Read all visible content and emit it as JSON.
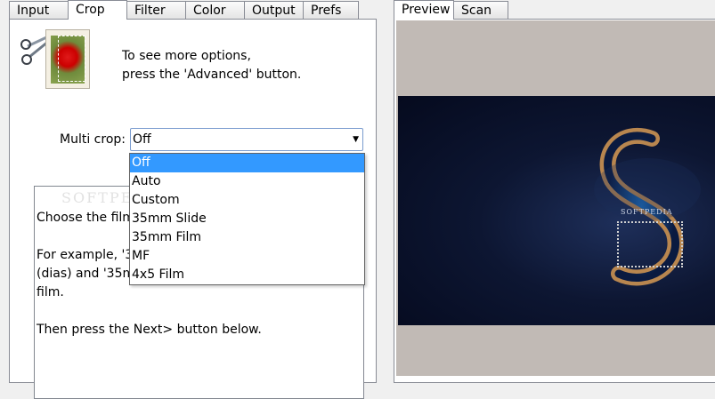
{
  "left_tabs": [
    "Input",
    "Crop",
    "Filter",
    "Color",
    "Output",
    "Prefs"
  ],
  "right_tabs": [
    "Preview",
    "Scan"
  ],
  "icons": {
    "scissors": "scissors-icon",
    "thumbnail": "crop-thumbnail-icon"
  },
  "info": {
    "line1": "To see more options,",
    "line2": "press the 'Advanced' button."
  },
  "multi_crop": {
    "label": "Multi crop:",
    "value": "Off",
    "options": [
      "Off",
      "Auto",
      "Custom",
      "35mm Slide",
      "35mm Film",
      "MF",
      "4x5 Film"
    ]
  },
  "description": {
    "p1": "Choose the film",
    "p2a": "For example, '3",
    "p2b": "(dias) and '35m",
    "p2c": "film.",
    "p3": "Then press the Next> button below."
  },
  "watermark_left": "SOFTPEDIA",
  "preview_watermark": "SOFTPEDIA",
  "colors": {
    "selection": "#3399ff",
    "preview_bg": "#c1bab5",
    "image_bg": "#0d1632"
  }
}
